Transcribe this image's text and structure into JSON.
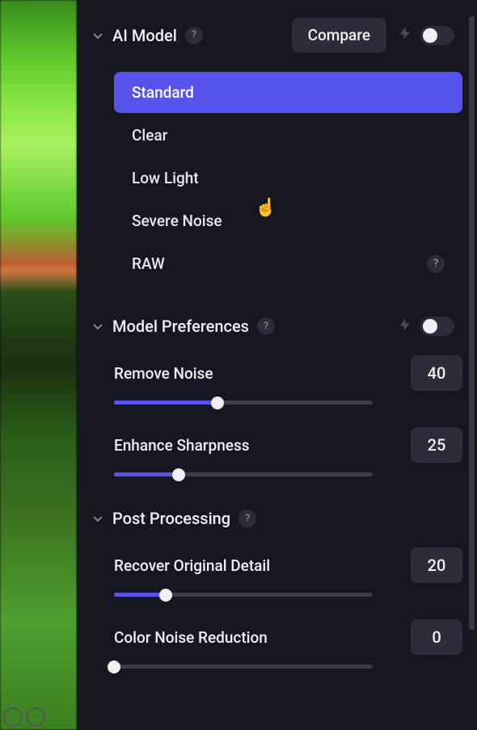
{
  "sections": {
    "ai_model": {
      "title": "AI Model",
      "compare_label": "Compare",
      "toggle_on": false,
      "items": [
        {
          "label": "Standard",
          "selected": true,
          "has_help": false
        },
        {
          "label": "Clear",
          "selected": false,
          "has_help": false
        },
        {
          "label": "Low Light",
          "selected": false,
          "has_help": false
        },
        {
          "label": "Severe Noise",
          "selected": false,
          "has_help": false
        },
        {
          "label": "RAW",
          "selected": false,
          "has_help": true
        }
      ]
    },
    "model_prefs": {
      "title": "Model Preferences",
      "toggle_on": false,
      "sliders": [
        {
          "label": "Remove Noise",
          "value": 40,
          "min": 0,
          "max": 100
        },
        {
          "label": "Enhance Sharpness",
          "value": 25,
          "min": 0,
          "max": 100
        }
      ]
    },
    "post_proc": {
      "title": "Post Processing",
      "sliders": [
        {
          "label": "Recover Original Detail",
          "value": 20,
          "min": 0,
          "max": 100
        },
        {
          "label": "Color Noise Reduction",
          "value": 0,
          "min": 0,
          "max": 100
        }
      ]
    }
  },
  "colors": {
    "accent": "#5754ee",
    "panel_bg": "#161720",
    "control_bg": "#2c2d38"
  },
  "help_glyph": "?"
}
